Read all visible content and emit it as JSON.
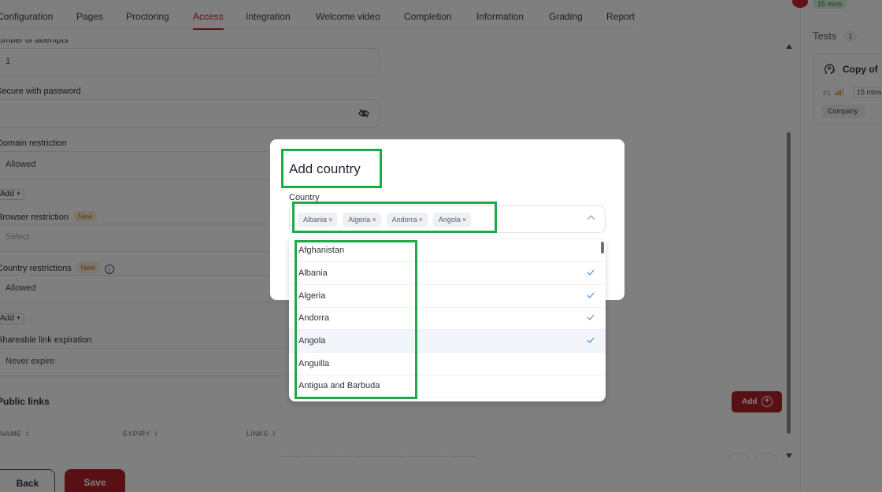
{
  "tabs": [
    {
      "label": "Configuration",
      "active": false
    },
    {
      "label": "Pages",
      "active": false
    },
    {
      "label": "Proctoring",
      "active": false
    },
    {
      "label": "Access",
      "active": true
    },
    {
      "label": "Integration",
      "active": false
    },
    {
      "label": "Welcome video",
      "active": false
    },
    {
      "label": "Completion",
      "active": false
    },
    {
      "label": "Information",
      "active": false
    },
    {
      "label": "Grading",
      "active": false
    },
    {
      "label": "Report",
      "active": false
    }
  ],
  "form": {
    "attempts_label": "Number of attempts",
    "attempts_value": "1",
    "password_label": "Secure with password",
    "domain_label": "Domain restriction",
    "domain_value": "Allowed",
    "add_label": "Add +",
    "browser_label": "Browser restriction",
    "new_badge": "New",
    "browser_placeholder": "Select",
    "country_label": "Country restrictions",
    "info_glyph": "i",
    "country_value": "Allowed",
    "link_label": "Shareable link expiration",
    "link_value": "Never expire"
  },
  "public_links": {
    "title": "Public links",
    "columns": [
      "NAME",
      "EXPIRY",
      "LINKS"
    ],
    "sort_glyph": "⇕",
    "add_label": "Add",
    "add_glyph": "+"
  },
  "footer": {
    "back_label": "Back",
    "save_label": "Save"
  },
  "right_panel": {
    "time_pill": "15 mins",
    "tests_title": "Tests",
    "tests_count": "1",
    "card": {
      "title": "Copy of",
      "number": "#1",
      "duration": "15 mins",
      "tag": "Company"
    }
  },
  "modal": {
    "title": "Add country",
    "label": "Country",
    "selected": [
      "Albania",
      "Algeria",
      "Andorra",
      "Angola"
    ],
    "remove_glyph": "×"
  },
  "dropdown": {
    "options": [
      {
        "name": "Afghanistan",
        "checked": false,
        "highlighted": false
      },
      {
        "name": "Albania",
        "checked": true,
        "highlighted": false
      },
      {
        "name": "Algeria",
        "checked": true,
        "highlighted": false
      },
      {
        "name": "Andorra",
        "checked": true,
        "highlighted": false
      },
      {
        "name": "Angola",
        "checked": true,
        "highlighted": true
      },
      {
        "name": "Anguilla",
        "checked": false,
        "highlighted": false
      },
      {
        "name": "Antigua and Barbuda",
        "checked": false,
        "highlighted": false
      }
    ]
  },
  "colors": {
    "accent_red": "#c8232b",
    "annotation_green": "#1faa4a",
    "check_blue": "#4a8fd6",
    "badge_bg": "#fcecd3"
  }
}
